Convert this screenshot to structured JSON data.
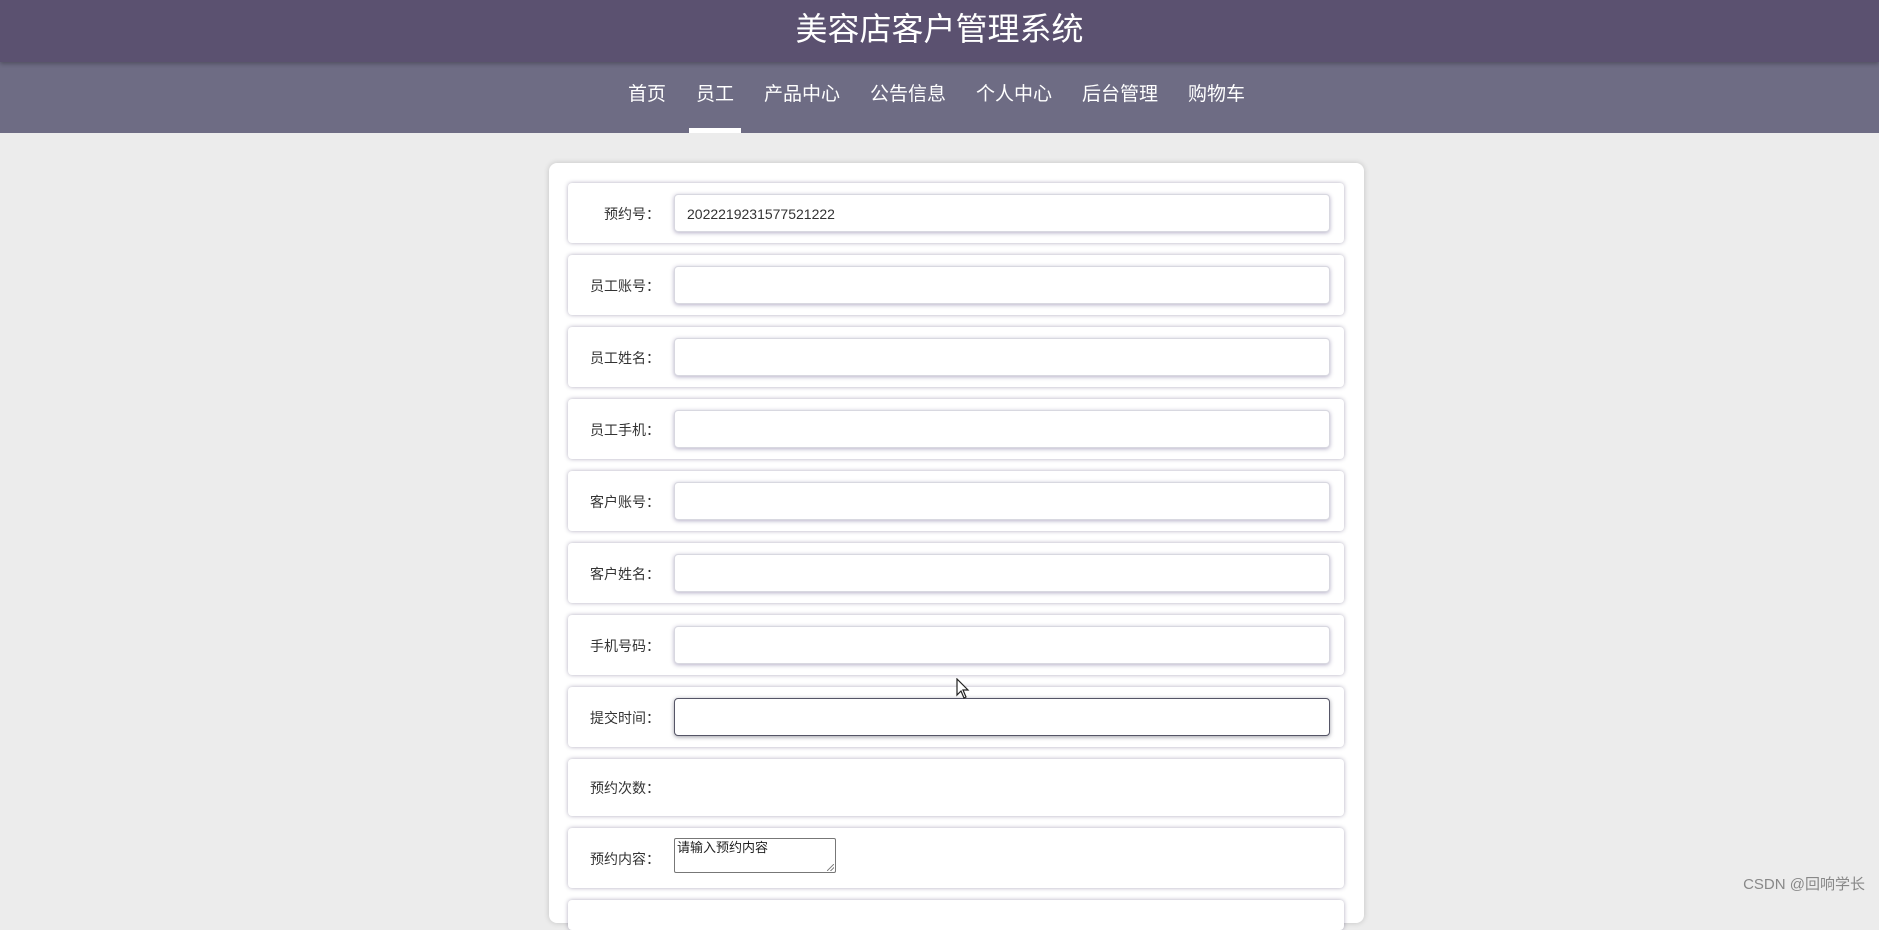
{
  "header": {
    "title": "美容店客户管理系统"
  },
  "nav": {
    "items": [
      {
        "label": "首页",
        "active": false
      },
      {
        "label": "员工",
        "active": true
      },
      {
        "label": "产品中心",
        "active": false
      },
      {
        "label": "公告信息",
        "active": false
      },
      {
        "label": "个人中心",
        "active": false
      },
      {
        "label": "后台管理",
        "active": false
      },
      {
        "label": "购物车",
        "active": false
      }
    ]
  },
  "form": {
    "fields": [
      {
        "label": "预约号：",
        "value": "2022219231577521222"
      },
      {
        "label": "员工账号：",
        "value": ""
      },
      {
        "label": "员工姓名：",
        "value": ""
      },
      {
        "label": "员工手机：",
        "value": ""
      },
      {
        "label": "客户账号：",
        "value": ""
      },
      {
        "label": "客户姓名：",
        "value": ""
      },
      {
        "label": "手机号码：",
        "value": ""
      },
      {
        "label": "提交时间：",
        "value": ""
      },
      {
        "label": "预约次数：",
        "value": ""
      },
      {
        "label": "预约内容：",
        "placeholder": "请输入预约内容"
      }
    ]
  },
  "watermark": "CSDN @回响学长",
  "colors": {
    "header_bg": "#5b5170",
    "nav_bg": "#6e6c84",
    "page_bg": "#ececec"
  }
}
